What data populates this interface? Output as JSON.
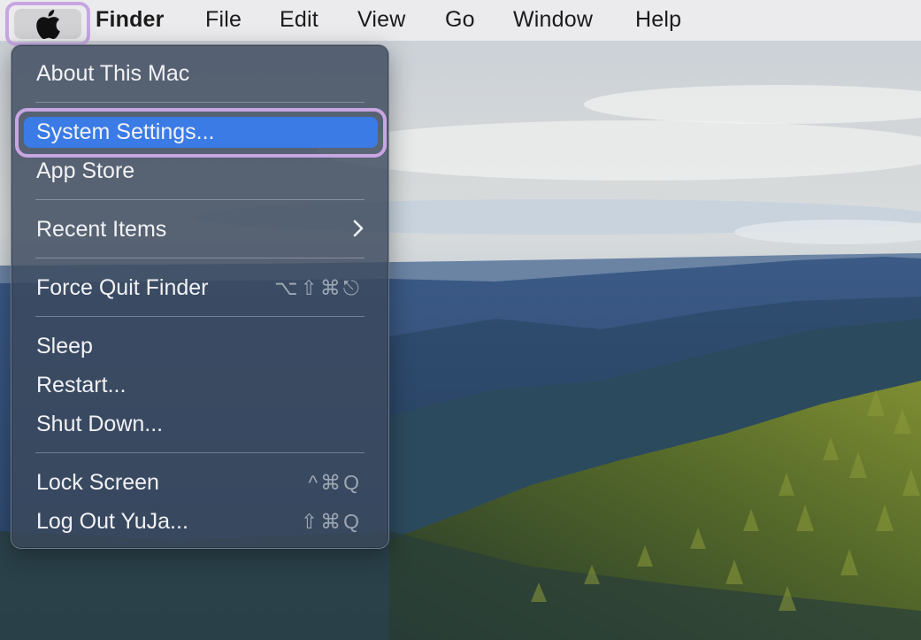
{
  "menubar": {
    "apple_icon": "apple-logo-icon",
    "items": [
      "Finder",
      "File",
      "Edit",
      "View",
      "Go",
      "Window",
      "Help"
    ]
  },
  "apple_menu": {
    "about": "About This Mac",
    "system_settings": "System Settings...",
    "app_store": "App Store",
    "recent_items": "Recent Items",
    "force_quit": {
      "label": "Force Quit Finder",
      "shortcut": "⌥⇧⌘⎋"
    },
    "sleep": "Sleep",
    "restart": "Restart...",
    "shut_down": "Shut Down...",
    "lock_screen": {
      "label": "Lock Screen",
      "shortcut": "^⌘Q"
    },
    "log_out": {
      "label": "Log Out YuJa...",
      "shortcut": "⇧⌘Q"
    }
  },
  "colors": {
    "highlight": "#3a7be6",
    "annotation_ring": "#c7a6e2"
  }
}
